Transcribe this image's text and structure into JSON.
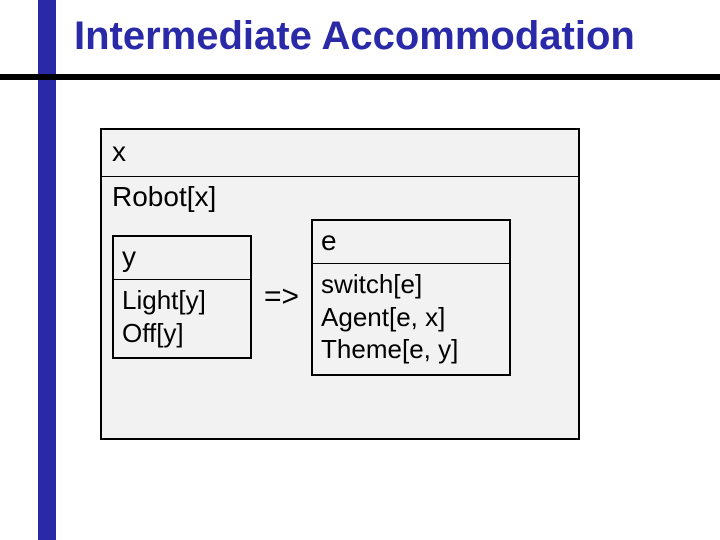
{
  "title": "Intermediate Accommodation",
  "outer": {
    "declaration": "x",
    "predicate": "Robot[x]"
  },
  "left_box": {
    "declaration": "y",
    "line1": "Light[y]",
    "line2": "Off[y]"
  },
  "arrow": "=>",
  "right_box": {
    "declaration": "e",
    "line1": "switch[e]",
    "line2": "Agent[e, x]",
    "line3": "Theme[e, y]"
  }
}
